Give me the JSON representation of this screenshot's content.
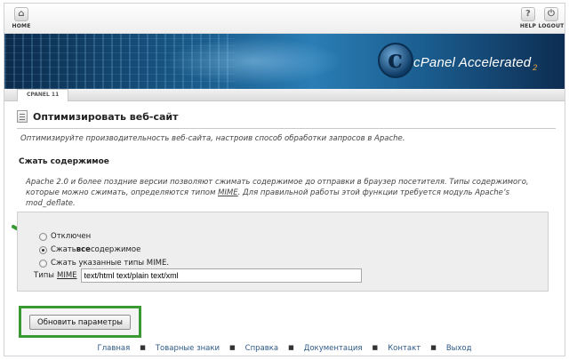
{
  "topnav": {
    "home_label": "HOME",
    "help_label": "HELP",
    "logout_label": "LOGOUT"
  },
  "banner": {
    "brand_text": "cPanel Accelerated",
    "brand_sub": "2"
  },
  "strip": {
    "tab_label": "CPANEL 11"
  },
  "page": {
    "title": "Оптимизировать веб-сайт",
    "description": "Оптимизируйте производительность веб-сайта, настроив способ обработки запросов в Apache."
  },
  "section": {
    "title": "Сжать содержимое",
    "desc_part1": "Apache 2.0 и более поздние версии позволяют сжимать содержимое до отправки в браузер посетителя. Типы содержимого, которые можно сжимать, определяются типом ",
    "desc_mime": "MIME",
    "desc_part2": ". Для правильной работы этой функции требуется модуль Apache’s mod_deflate."
  },
  "options": [
    {
      "label_pre": "Отключен",
      "label_bold": "",
      "label_post": "",
      "selected": false
    },
    {
      "label_pre": "Сжать ",
      "label_bold": "все",
      "label_post": " содержимое",
      "selected": true
    },
    {
      "label_pre": "Сжать указанные типы MIME.",
      "label_bold": "",
      "label_post": "",
      "selected": false
    }
  ],
  "mime": {
    "label_pre": "Типы",
    "label_mime": "MIME",
    "value": "text/html text/plain text/xml"
  },
  "update_button_label": "Обновить параметры",
  "footer": {
    "links": [
      "Главная",
      "Товарные знаки",
      "Справка",
      "Документация",
      "Контакт",
      "Выход"
    ]
  },
  "colors": {
    "highlight": "#3a9a32",
    "link": "#2d5a8a",
    "banner": "#1a5c8c"
  }
}
